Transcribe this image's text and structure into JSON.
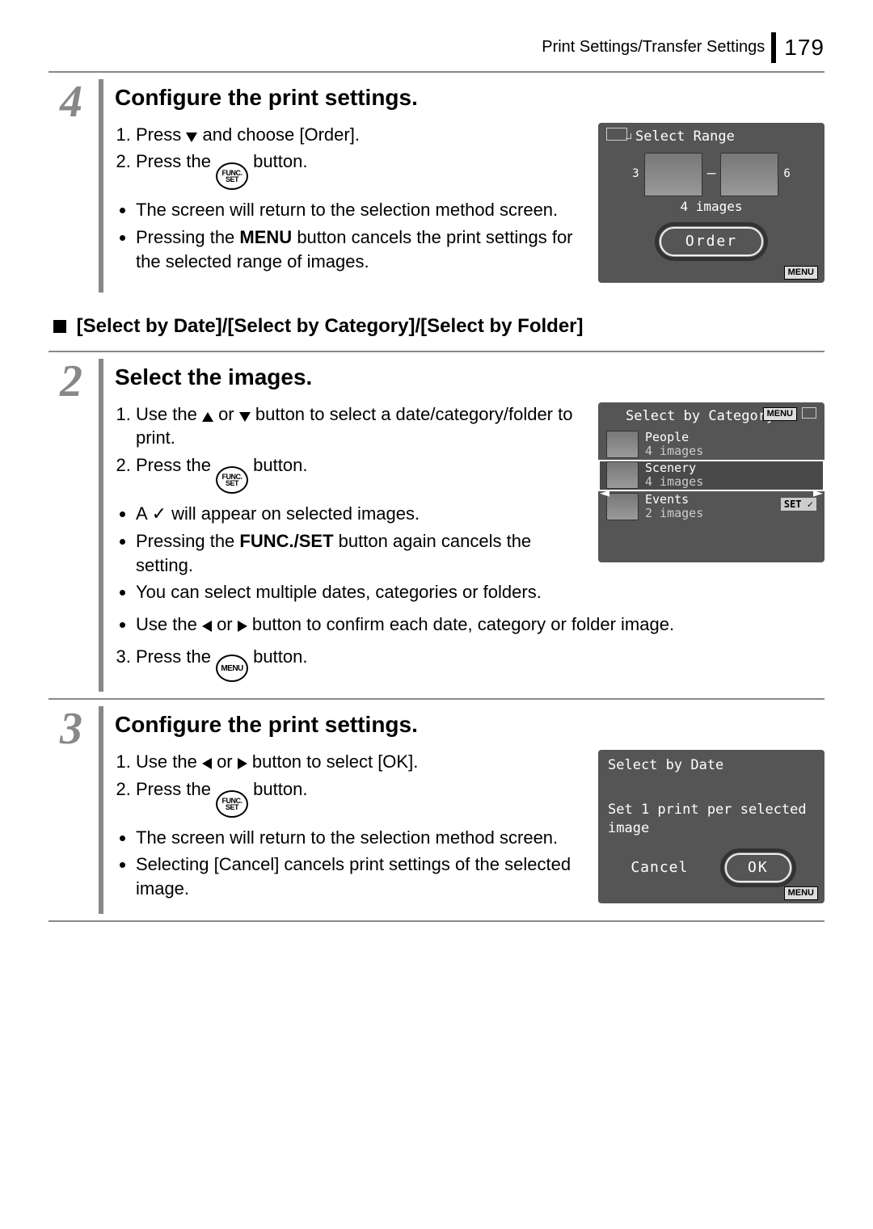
{
  "header": {
    "title": "Print Settings/Transfer Settings",
    "page_number": "179"
  },
  "step4": {
    "number": "4",
    "title": "Configure the print settings.",
    "ol": {
      "i1a": "Press ",
      "i1b": " and choose [Order].",
      "i2a": "Press the ",
      "i2b": " button."
    },
    "ul": {
      "i1": "The screen will return to the selection method screen.",
      "i2a": "Pressing the ",
      "i2b": "MENU",
      "i2c": " button cancels the print settings for the selected range of images."
    },
    "cam": {
      "title": "Select Range",
      "left_num": "3",
      "right_num": "6",
      "count": "4 images",
      "button": "Order",
      "menu": "MENU"
    }
  },
  "subheading": "[Select by Date]/[Select by Category]/[Select by Folder]",
  "step2": {
    "number": "2",
    "title": "Select the images.",
    "ol": {
      "i1a": "Use the ",
      "i1b": " or ",
      "i1c": " button to select a date/category/folder to print.",
      "i2a": "Press the ",
      "i2b": " button."
    },
    "ul": {
      "i1a": "A ",
      "i1b": " will appear on selected images.",
      "i2a": "Pressing the ",
      "i2b": "FUNC./SET",
      "i2c": " button again cancels the setting.",
      "i3": "You can select multiple dates, categories or folders.",
      "i4a": "Use the ",
      "i4b": " or ",
      "i4c": " button to confirm each date, category or folder image."
    },
    "ol2": {
      "i3a": "Press the ",
      "i3b": " button."
    },
    "cam": {
      "title": "Select by Category",
      "menu": "MENU",
      "set": "SET",
      "row1_name": "People",
      "row1_count": "4 images",
      "row2_name": "Scenery",
      "row2_count": "4 images",
      "row3_name": "Events",
      "row3_count": "2 images"
    }
  },
  "step3": {
    "number": "3",
    "title": "Configure the print settings.",
    "ol": {
      "i1a": "Use the ",
      "i1b": " or ",
      "i1c": " button to select [OK].",
      "i2a": "Press the ",
      "i2b": " button."
    },
    "ul": {
      "i1": "The screen will return to the selection method screen.",
      "i2": "Selecting [Cancel] cancels print settings of the selected image."
    },
    "cam": {
      "title": "Select by Date",
      "msg": "Set 1 print per selected image",
      "cancel": "Cancel",
      "ok": "OK",
      "menu": "MENU"
    }
  },
  "icons": {
    "func_top": "FUNC.",
    "func_bot": "SET",
    "menu": "MENU"
  }
}
